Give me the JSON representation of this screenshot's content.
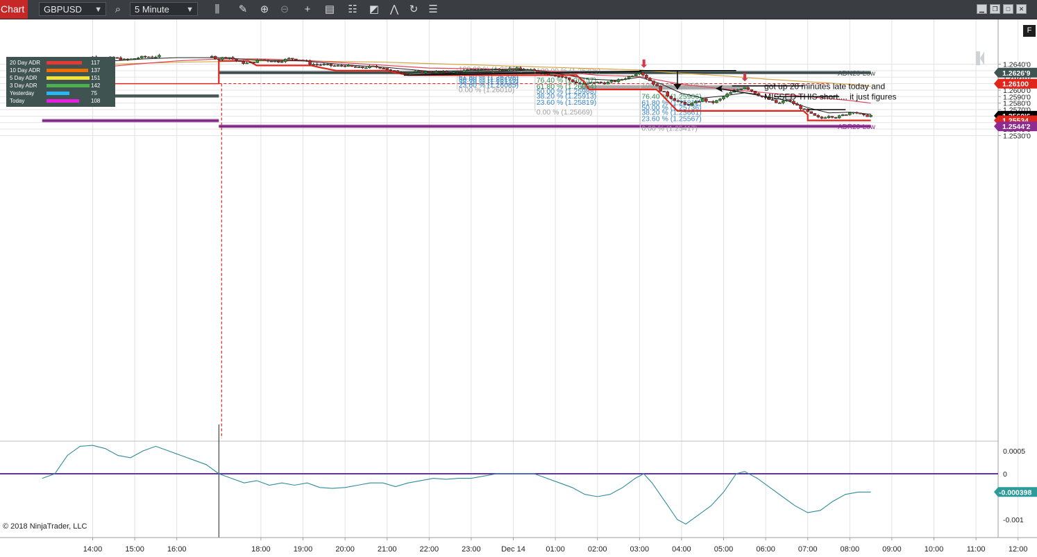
{
  "toolbar": {
    "chart_tab": "Chart",
    "instrument": "GBPUSD",
    "interval": "5 Minute",
    "icons": [
      "magnifier-icon",
      "bar-type-icon",
      "drawing-pencil-icon",
      "zoom-in-icon",
      "zoom-out-icon",
      "crosshair-icon",
      "data-box-icon",
      "properties-icon",
      "templates-icon",
      "indicators-icon",
      "reload-icon",
      "strategy-icon"
    ]
  },
  "window_buttons": [
    "minimize",
    "restore",
    "maximize",
    "close"
  ],
  "f_button": "F",
  "copyright": "© 2018 NinjaTrader, LLC",
  "colors": {
    "up_candle": "#2e9b2e",
    "down_candle": "#c62828",
    "adn_zone": "#3f5350",
    "adr_zone": "#8e2b91",
    "stop_line": "#e0251b",
    "ema_fast": "#1e1e1e",
    "ema_mid": "#e0485a",
    "ema_slow": "#d9a441",
    "oscillator": "#2e8b9a",
    "zero_line": "#4b1a8a"
  },
  "legend": [
    {
      "label": "20 Day ADR",
      "value": "117",
      "color": "#e53935",
      "fill": 0.82
    },
    {
      "label": "10 Day ADR",
      "value": "137",
      "color": "#ef6c00",
      "fill": 0.96
    },
    {
      "label": "5 Day ADR",
      "value": "151",
      "color": "#f4e23a",
      "fill": 1.0
    },
    {
      "label": "3 Day ADR",
      "value": "142",
      "color": "#4caf50",
      "fill": 1.0
    },
    {
      "label": "Yesterday",
      "value": "75",
      "color": "#29b6f6",
      "fill": 0.53
    },
    {
      "label": "Today",
      "value": "108",
      "color": "#e91ee0",
      "fill": 0.76
    }
  ],
  "chart_data": {
    "type": "candlestick",
    "instrument": "GBPUSD",
    "interval": "5 Minute",
    "price_axis": {
      "range": [
        1.2524,
        1.2651
      ],
      "ticks": [
        "1.2640'0",
        "1.2630'0",
        "1.2620'0",
        "1.2610'0",
        "1.2600'0",
        "1.2590'0",
        "1.2580'0",
        "1.2570'0",
        "1.2560'0",
        "1.2550'0",
        "1.2540'0",
        "1.2530'0"
      ],
      "tick_values": [
        1.264,
        1.263,
        1.262,
        1.261,
        1.26,
        1.259,
        1.258,
        1.257,
        1.256,
        1.255,
        1.254,
        1.253
      ]
    },
    "time_axis": {
      "ticks": [
        "14:00",
        "15:00",
        "16:00",
        "18:00",
        "19:00",
        "20:00",
        "21:00",
        "22:00",
        "23:00",
        "Dec 14",
        "01:00",
        "02:00",
        "03:00",
        "04:00",
        "05:00",
        "06:00",
        "07:00",
        "08:00",
        "09:00",
        "10:00",
        "11:00",
        "12:00"
      ],
      "tick_hours": [
        -10,
        -9,
        -8,
        -6,
        -5,
        -4,
        -3,
        -2,
        -1,
        0,
        1,
        2,
        3,
        4,
        5,
        6,
        7,
        8,
        9,
        10,
        11,
        12
      ]
    },
    "session_break_hour": -7,
    "price_labels": [
      {
        "text": "1.2626'9",
        "value": 1.26269,
        "style": "adn"
      },
      {
        "text": "1.26100",
        "value": 1.261,
        "style": "red"
      },
      {
        "text": "1.2560'6",
        "value": 1.25606,
        "style": "last"
      },
      {
        "text": "1.25534",
        "value": 1.25534,
        "style": "red"
      },
      {
        "text": "1.2544'2",
        "value": 1.25442,
        "style": "adr"
      }
    ],
    "zones": [
      {
        "name": "ADN20-Low",
        "from": 1.26245,
        "to": 1.26295,
        "line": 1.26269,
        "start_hour": -7.0,
        "end_hour": 8.5,
        "color": "#3f5350"
      },
      {
        "name": "",
        "from": 1.25885,
        "to": 1.25935,
        "line": 1.2591,
        "start_hour": -11.2,
        "end_hour": -7.0,
        "color": "#3f5350"
      },
      {
        "name": "ADR20-Low",
        "from": 1.25418,
        "to": 1.25468,
        "line": 1.25442,
        "start_hour": -7.0,
        "end_hour": 8.5,
        "color": "#8e2b91"
      },
      {
        "name": "",
        "from": 1.25505,
        "to": 1.25555,
        "line": 1.2553,
        "start_hour": -11.2,
        "end_hour": -7.0,
        "color": "#8e2b91"
      },
      {
        "name": "",
        "from": 1.2601,
        "to": 1.26075,
        "line": null,
        "start_hour": 1.6,
        "end_hour": 5.6,
        "color": "#9c9c9c"
      }
    ],
    "zone_labels": [
      "ADN20-Low",
      "ADR20-Low"
    ],
    "level_line": {
      "value": 1.261,
      "solid_to_hour": -7.0,
      "dashed_from_hour": -7.0
    },
    "fib_sets": [
      {
        "levels": [
          {
            "text": "100.00 % (1.26331)",
            "value": 1.26331,
            "color": "#9e9e9e"
          },
          {
            "text": "61.80 % (1.26208)",
            "value": 1.26208,
            "color": "#3a86c8"
          },
          {
            "text": "50.00 % (1.26170)",
            "value": 1.2617,
            "color": "#3a86c8"
          },
          {
            "text": "38.20 % (1.26132)",
            "value": 1.26132,
            "color": "#3a86c8"
          },
          {
            "text": "23.60 % (1.26085)",
            "value": 1.26085,
            "color": "#3a86c8"
          },
          {
            "text": "0.00 % (1.26010)",
            "value": 1.2601,
            "color": "#9e9e9e"
          }
        ],
        "x_hour": -1.3
      },
      {
        "levels": [
          {
            "text": "100.00 % (1.26306)",
            "value": 1.26306,
            "color": "#9e9e9e"
          },
          {
            "text": "76.40 % (1.26157)",
            "value": 1.26157,
            "color": "#2e8b57"
          },
          {
            "text": "61.80 % (1.26064)",
            "value": 1.26064,
            "color": "#2e8b57"
          },
          {
            "text": "50.00 % (1.25988)",
            "value": 1.25988,
            "color": "#3a86c8"
          },
          {
            "text": "38.20 % (1.25913)",
            "value": 1.25913,
            "color": "#3a86c8"
          },
          {
            "text": "23.60 % (1.25819)",
            "value": 1.25819,
            "color": "#3a86c8"
          },
          {
            "text": "0.00 % (1.25669)",
            "value": 1.25669,
            "color": "#9e9e9e"
          }
        ],
        "x_hour": 0.55
      },
      {
        "levels": [
          {
            "text": "100.00 % (1.26082)",
            "value": 1.26082,
            "color": "#9e9e9e"
          },
          {
            "text": "76.40 % (1.25906)",
            "value": 1.25906,
            "color": "#2e8b57"
          },
          {
            "text": "61.80 % (1.25812)",
            "value": 1.25812,
            "color": "#3a86c8"
          },
          {
            "text": "50.00 % (1.25736)",
            "value": 1.25736,
            "color": "#3a86c8"
          },
          {
            "text": "38.20 % (1.25661)",
            "value": 1.25661,
            "color": "#3a86c8"
          },
          {
            "text": "23.60 % (1.25567)",
            "value": 1.25567,
            "color": "#3a86c8"
          },
          {
            "text": "0.00 % (1.25417)",
            "value": 1.25417,
            "color": "#9e9e9e"
          }
        ],
        "x_hour": 3.05
      }
    ],
    "annotation": {
      "line1": "got up 20 minutes late today and",
      "line2": "MISSED THIS short....  it just figures"
    },
    "price_path": [
      [
        -10.5,
        1.263
      ],
      [
        -10.2,
        1.2642
      ],
      [
        -10.0,
        1.2651
      ],
      [
        -9.8,
        1.2648
      ],
      [
        -9.5,
        1.265
      ],
      [
        -9.2,
        1.2646
      ],
      [
        -9.0,
        1.2649
      ],
      [
        -8.8,
        1.2651
      ],
      [
        -8.4,
        1.2652
      ],
      [
        -7.2,
        1.2652
      ],
      [
        -7.0,
        1.2648
      ],
      [
        -6.8,
        1.2652
      ],
      [
        -6.5,
        1.2643
      ],
      [
        -6.3,
        1.2641
      ],
      [
        -6.0,
        1.2647
      ],
      [
        -5.6,
        1.2644
      ],
      [
        -5.3,
        1.2649
      ],
      [
        -5.0,
        1.2646
      ],
      [
        -4.8,
        1.264
      ],
      [
        -4.5,
        1.2639
      ],
      [
        -4.2,
        1.2637
      ],
      [
        -4.0,
        1.2638
      ],
      [
        -3.7,
        1.2634
      ],
      [
        -3.4,
        1.2636
      ],
      [
        -3.1,
        1.2635
      ],
      [
        -2.9,
        1.2629
      ],
      [
        -2.5,
        1.2627
      ],
      [
        -2.2,
        1.2628
      ],
      [
        -1.8,
        1.2628
      ],
      [
        -1.5,
        1.2627
      ],
      [
        -1.2,
        1.2629
      ],
      [
        -0.9,
        1.2632
      ],
      [
        -0.5,
        1.2632
      ],
      [
        -0.2,
        1.2633
      ],
      [
        0.3,
        1.2632
      ],
      [
        0.6,
        1.2628
      ],
      [
        0.9,
        1.2624
      ],
      [
        1.2,
        1.262
      ],
      [
        1.5,
        1.2611
      ],
      [
        1.7,
        1.2609
      ],
      [
        1.9,
        1.2612
      ],
      [
        2.2,
        1.2611
      ],
      [
        2.5,
        1.2615
      ],
      [
        2.8,
        1.2622
      ],
      [
        3.0,
        1.2629
      ],
      [
        3.15,
        1.262
      ],
      [
        3.3,
        1.2612
      ],
      [
        3.5,
        1.26
      ],
      [
        3.7,
        1.259
      ],
      [
        3.9,
        1.2583
      ],
      [
        4.1,
        1.2577
      ],
      [
        4.3,
        1.258
      ],
      [
        4.5,
        1.2586
      ],
      [
        4.7,
        1.258
      ],
      [
        4.9,
        1.2585
      ],
      [
        5.1,
        1.2594
      ],
      [
        5.3,
        1.26
      ],
      [
        5.5,
        1.2605
      ],
      [
        5.7,
        1.2598
      ],
      [
        5.9,
        1.259
      ],
      [
        6.1,
        1.2585
      ],
      [
        6.3,
        1.2579
      ],
      [
        6.5,
        1.2585
      ],
      [
        6.7,
        1.2578
      ],
      [
        6.9,
        1.257
      ],
      [
        7.1,
        1.2562
      ],
      [
        7.3,
        1.2556
      ],
      [
        7.5,
        1.2561
      ],
      [
        7.7,
        1.2558
      ],
      [
        7.9,
        1.2563
      ],
      [
        8.1,
        1.2568
      ],
      [
        8.3,
        1.256
      ],
      [
        8.5,
        1.2561
      ]
    ],
    "trail_stop": [
      [
        -7.0,
        1.261
      ],
      [
        -7.0,
        1.2645
      ],
      [
        -6.3,
        1.2645
      ],
      [
        -6.1,
        1.2638
      ],
      [
        -4.8,
        1.2638
      ],
      [
        -4.6,
        1.2635
      ],
      [
        -4.2,
        1.263
      ],
      [
        -3.0,
        1.263
      ],
      [
        -2.5,
        1.2623
      ],
      [
        0.4,
        1.2623
      ],
      [
        0.5,
        1.2623
      ],
      [
        1.5,
        1.2623
      ],
      [
        1.7,
        1.2612
      ],
      [
        1.8,
        1.2601
      ],
      [
        3.4,
        1.2601
      ],
      [
        3.5,
        1.2595
      ],
      [
        3.9,
        1.2568
      ],
      [
        6.1,
        1.2568
      ],
      [
        6.6,
        1.2568
      ],
      [
        6.9,
        1.2568
      ],
      [
        7.0,
        1.2562
      ],
      [
        7.0,
        1.25534
      ],
      [
        8.5,
        1.25534
      ]
    ],
    "ema_fast": [
      [
        -11.0,
        1.2625
      ],
      [
        -10.2,
        1.2637
      ],
      [
        -9.5,
        1.2645
      ],
      [
        -8.8,
        1.2648
      ],
      [
        -8.0,
        1.265
      ],
      [
        -7.0,
        1.265
      ],
      [
        -6.0,
        1.2646
      ],
      [
        -5.0,
        1.2645
      ],
      [
        -4.0,
        1.2639
      ],
      [
        -3.0,
        1.2635
      ],
      [
        -2.0,
        1.2629
      ],
      [
        -1.0,
        1.263
      ],
      [
        0.0,
        1.2632
      ],
      [
        0.6,
        1.263
      ],
      [
        1.2,
        1.2624
      ],
      [
        1.8,
        1.2617
      ],
      [
        2.5,
        1.2615
      ],
      [
        3.0,
        1.262
      ],
      [
        3.5,
        1.261
      ],
      [
        4.0,
        1.2595
      ],
      [
        4.5,
        1.2588
      ],
      [
        5.0,
        1.2591
      ],
      [
        5.5,
        1.2596
      ],
      [
        6.0,
        1.259
      ],
      [
        6.5,
        1.2584
      ],
      [
        7.0,
        1.2573
      ],
      [
        7.5,
        1.2565
      ],
      [
        8.0,
        1.2566
      ],
      [
        8.5,
        1.2563
      ]
    ],
    "ema_mid": [
      [
        -11.0,
        1.2627
      ],
      [
        -10.0,
        1.2634
      ],
      [
        -9.0,
        1.264
      ],
      [
        -8.0,
        1.2645
      ],
      [
        -7.0,
        1.2648
      ],
      [
        -6.0,
        1.2648
      ],
      [
        -5.0,
        1.2646
      ],
      [
        -4.0,
        1.2642
      ],
      [
        -3.0,
        1.2638
      ],
      [
        -2.0,
        1.2634
      ],
      [
        -1.0,
        1.2633
      ],
      [
        0.0,
        1.2632
      ],
      [
        1.0,
        1.2629
      ],
      [
        2.0,
        1.2623
      ],
      [
        3.0,
        1.2621
      ],
      [
        4.0,
        1.2609
      ],
      [
        5.0,
        1.2602
      ],
      [
        6.0,
        1.2596
      ],
      [
        7.0,
        1.259
      ],
      [
        8.0,
        1.2584
      ],
      [
        8.5,
        1.258
      ]
    ],
    "ema_slow": [
      [
        -11.0,
        1.2637
      ],
      [
        -10.0,
        1.2639
      ],
      [
        -9.0,
        1.2641
      ],
      [
        -8.0,
        1.2643
      ],
      [
        -7.0,
        1.2644
      ],
      [
        -6.0,
        1.2645
      ],
      [
        -5.0,
        1.2645
      ],
      [
        -4.0,
        1.2644
      ],
      [
        -3.0,
        1.2643
      ],
      [
        -2.0,
        1.2641
      ],
      [
        -1.0,
        1.2639
      ],
      [
        0.0,
        1.2637
      ],
      [
        1.0,
        1.2635
      ],
      [
        2.0,
        1.2633
      ],
      [
        3.0,
        1.2631
      ],
      [
        4.0,
        1.2626
      ],
      [
        5.0,
        1.2622
      ],
      [
        6.0,
        1.2617
      ],
      [
        7.0,
        1.2613
      ],
      [
        8.0,
        1.2609
      ],
      [
        8.5,
        1.2606
      ]
    ],
    "trendline": [
      [
        -2.6,
        1.2623
      ],
      [
        3.05,
        1.2629
      ]
    ],
    "swing_lines": [
      {
        "hour_from": 3.0,
        "hour_to": 5.3,
        "value": 1.263
      },
      {
        "hour_from": 5.2,
        "hour_to": 6.9,
        "value": 1.26065
      },
      {
        "hour_from": 6.2,
        "hour_to": 7.75,
        "value": 1.259
      },
      {
        "hour_from": 7.0,
        "hour_to": 7.9,
        "value": 1.257
      }
    ],
    "down_arrows": [
      {
        "hour": 3.1,
        "value": 1.2633
      },
      {
        "hour": 5.5,
        "value": 1.2612
      }
    ],
    "oscillator": {
      "ticks": [
        "0.0005",
        "0",
        "-0.000398",
        "-0.001"
      ],
      "tick_values": [
        0.0005,
        0,
        -0.000398,
        -0.001
      ],
      "last": "-0.000398",
      "range": [
        -0.00125,
        0.00075
      ],
      "values": [
        [
          -11.2,
          -0.0001
        ],
        [
          -10.9,
          0.0
        ],
        [
          -10.6,
          0.0004
        ],
        [
          -10.3,
          0.0006
        ],
        [
          -10.0,
          0.00062
        ],
        [
          -9.7,
          0.00055
        ],
        [
          -9.4,
          0.0004
        ],
        [
          -9.1,
          0.00035
        ],
        [
          -8.8,
          0.0005
        ],
        [
          -8.5,
          0.0006
        ],
        [
          -8.2,
          0.0005
        ],
        [
          -7.9,
          0.0004
        ],
        [
          -7.6,
          0.0003
        ],
        [
          -7.3,
          0.0002
        ],
        [
          -7.0,
          0.0
        ],
        [
          -6.7,
          -0.0001
        ],
        [
          -6.4,
          -0.0002
        ],
        [
          -6.1,
          -0.00015
        ],
        [
          -5.8,
          -0.00025
        ],
        [
          -5.5,
          -0.0002
        ],
        [
          -5.2,
          -0.00025
        ],
        [
          -4.9,
          -0.0002
        ],
        [
          -4.6,
          -0.0003
        ],
        [
          -4.3,
          -0.00032
        ],
        [
          -4.0,
          -0.0003
        ],
        [
          -3.7,
          -0.00025
        ],
        [
          -3.4,
          -0.0002
        ],
        [
          -3.1,
          -0.0002
        ],
        [
          -2.8,
          -0.00028
        ],
        [
          -2.5,
          -0.0002
        ],
        [
          -2.2,
          -0.00015
        ],
        [
          -1.9,
          -0.0001
        ],
        [
          -1.6,
          -0.00012
        ],
        [
          -1.3,
          -0.0001
        ],
        [
          -1.0,
          -0.0001
        ],
        [
          -0.7,
          -5e-05
        ],
        [
          -0.4,
          0.0
        ],
        [
          -0.1,
          0.0
        ],
        [
          0.2,
          0.0
        ],
        [
          0.5,
          0.0
        ],
        [
          0.8,
          -0.0001
        ],
        [
          1.1,
          -0.0002
        ],
        [
          1.4,
          -0.0003
        ],
        [
          1.7,
          -0.00045
        ],
        [
          2.0,
          -0.0005
        ],
        [
          2.3,
          -0.00045
        ],
        [
          2.6,
          -0.0003
        ],
        [
          2.9,
          -0.0001
        ],
        [
          3.1,
          0.0
        ],
        [
          3.3,
          -0.0002
        ],
        [
          3.6,
          -0.0006
        ],
        [
          3.9,
          -0.001
        ],
        [
          4.1,
          -0.0011
        ],
        [
          4.4,
          -0.0009
        ],
        [
          4.7,
          -0.0007
        ],
        [
          5.0,
          -0.0004
        ],
        [
          5.3,
          0.0
        ],
        [
          5.5,
          5e-05
        ],
        [
          5.8,
          -0.0001
        ],
        [
          6.1,
          -0.0003
        ],
        [
          6.4,
          -0.0005
        ],
        [
          6.7,
          -0.0007
        ],
        [
          7.0,
          -0.00085
        ],
        [
          7.3,
          -0.0008
        ],
        [
          7.6,
          -0.0006
        ],
        [
          7.9,
          -0.00045
        ],
        [
          8.2,
          -0.0004
        ],
        [
          8.5,
          -0.000398
        ]
      ]
    }
  }
}
